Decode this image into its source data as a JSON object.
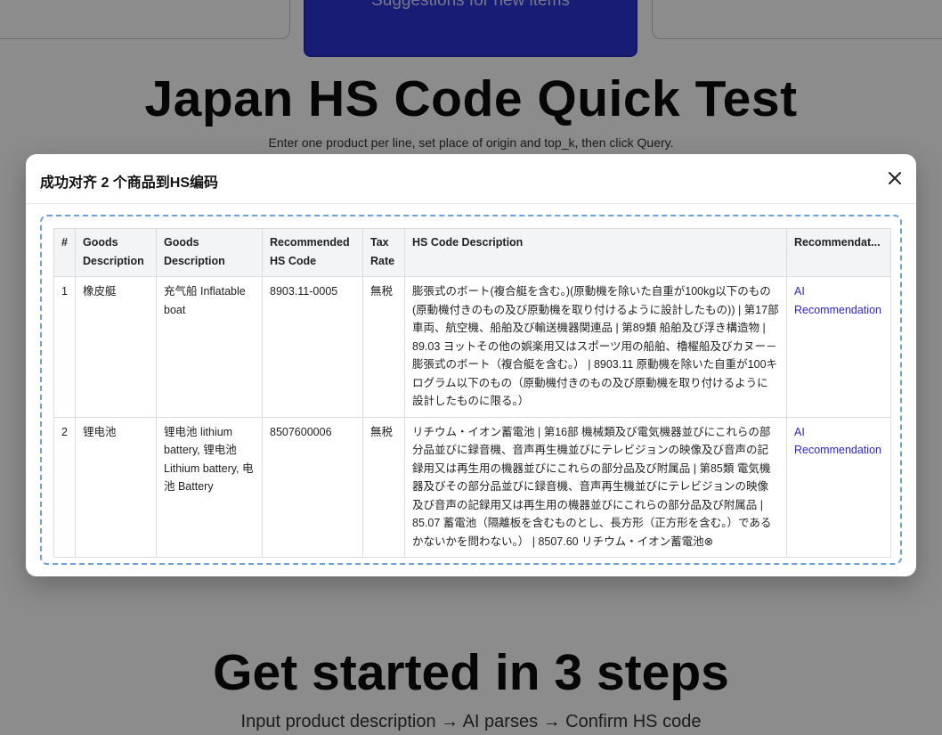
{
  "background": {
    "top_button_label": "Suggestions for new items",
    "title": "Japan HS Code Quick Test",
    "subtitle": "Enter one product per line, set place of origin and top_k, then click Query.",
    "steps_title": "Get started in 3 steps",
    "steps_subtitle": "Input product description → AI parses → Confirm HS code"
  },
  "modal": {
    "title": "成功对齐 2 个商品到HS编码",
    "close_icon": "close-icon",
    "table": {
      "headers": [
        "#",
        "Goods Description",
        "Goods Description",
        "Recommended HS Code",
        "Tax Rate",
        "HS Code Description",
        "Recommendat..."
      ],
      "rows": [
        {
          "index": "1",
          "goods_desc_1": "橡皮艇",
          "goods_desc_2": "充气船 Inflatable boat",
          "hs_code": "8903.11-0005",
          "tax_rate": "無税",
          "hs_desc": "膨張式のボート(複合艇を含む。)(原動機を除いた自重が100kg以下のもの(原動機付きのもの及び原動機を取り付けるように設計したもの)) | 第17部 車両、航空機、船舶及び輸送機器関連品 | 第89類 船舶及び浮き構造物 | 89.03 ヨットその他の娯楽用又はスポーツ用の船舶、櫓櫂船及びカヌー－膨張式のボート（複合艇を含む。） | 8903.11 原動機を除いた自重が100キログラム以下のもの（原動機付きのもの及び原動機を取り付けるように設計したものに限る。）",
          "recommendation": "AI Recommendation"
        },
        {
          "index": "2",
          "goods_desc_1": "锂电池",
          "goods_desc_2": "锂电池 lithium battery, 锂电池 Lithium battery, 电池 Battery",
          "hs_code": "8507600006",
          "tax_rate": "無税",
          "hs_desc": "リチウム・イオン蓄電池 | 第16部 機械類及び電気機器並びにこれらの部分品並びに録音機、音声再生機並びにテレビジョンの映像及び音声の記録用又は再生用の機器並びにこれらの部分品及び附属品 | 第85類 電気機器及びその部分品並びに録音機、音声再生機並びにテレビジョンの映像及び音声の記録用又は再生用の機器並びにこれらの部分品及び附属品 | 85.07 蓄電池（隔離板を含むものとし、長方形（正方形を含む。）であるかないかを問わない。） | 8507.60 リチウム・イオン蓄電池⊗",
          "recommendation": "AI Recommendation"
        }
      ]
    }
  },
  "colors": {
    "accent_button": "#2c33d6",
    "link": "#2a25d6",
    "dashed_border": "#6aa2e0"
  }
}
